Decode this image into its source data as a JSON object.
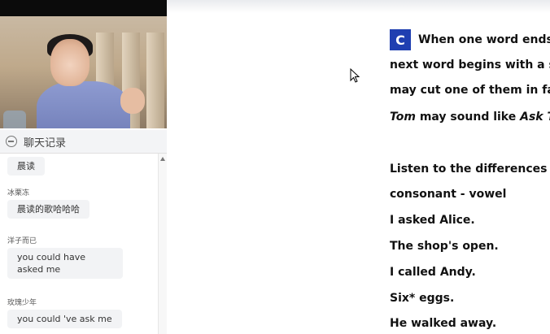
{
  "chat": {
    "title": "聊天记录",
    "messages": [
      {
        "user": "",
        "text": "晨读"
      },
      {
        "user": "冰栗冻",
        "text": "晨读的歌哈哈哈"
      },
      {
        "user": "洋子而已",
        "text": "you could have asked me"
      },
      {
        "user": "玫瑰少年",
        "text": "you could 've ask me"
      }
    ]
  },
  "doc": {
    "badge": "C",
    "line1": "When one word ends w",
    "line2": "next word begins with a sim",
    "line3": "may cut one of them in fa",
    "line4_a": "Tom",
    "line4_b": " may sound like ",
    "line4_c": "Ask To",
    "line5": "Listen to the differences in t",
    "line6": "consonant - vowel",
    "line7": "I asked Alice.",
    "line8": "The shop's open.",
    "line9": "I called Andy.",
    "line10": "Six* eggs.",
    "line11": "He walked away."
  },
  "colors": {
    "badge": "#1f3fb1",
    "chat_bubble": "#f2f3f5"
  }
}
